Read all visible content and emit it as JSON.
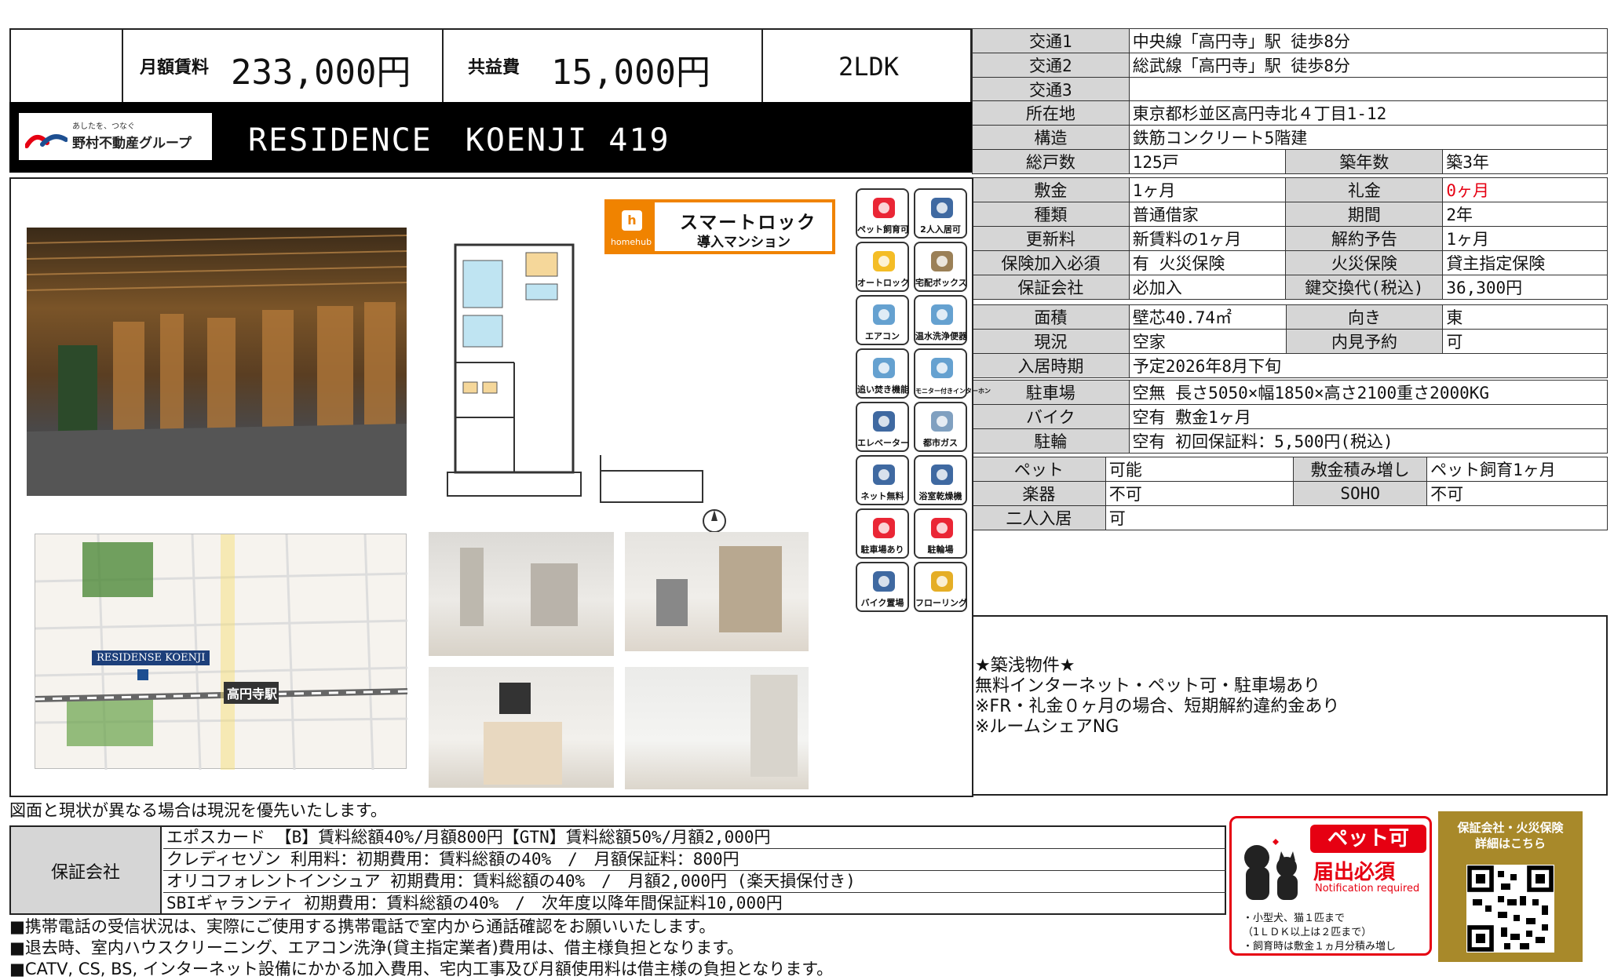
{
  "header": {
    "rent_label": "月額賃料",
    "rent_value": "233,000円",
    "fee_label": "共益費",
    "fee_value": "15,000円",
    "layout_type": "2LDK",
    "building_name": "RESIDENCE　KOENJI 419",
    "logo_tagline": "あしたを、つなぐ",
    "logo_name": "野村不動産グループ"
  },
  "transport": [
    {
      "label": "交通1",
      "value": "中央線「高円寺」駅 徒歩8分"
    },
    {
      "label": "交通2",
      "value": "総武線「高円寺」駅 徒歩8分"
    },
    {
      "label": "交通3",
      "value": ""
    }
  ],
  "building": {
    "address_label": "所在地",
    "address": "東京都杉並区高円寺北４丁目1-12",
    "structure_label": "構造",
    "structure": "鉄筋コンクリート5階建",
    "units_label": "総戸数",
    "units": "125戸",
    "age_label": "築年数",
    "age": "築3年"
  },
  "contract": {
    "deposit_label": "敷金",
    "deposit": "1ヶ月",
    "key_money_label": "礼金",
    "key_money": "0ヶ月",
    "type_label": "種類",
    "type": "普通借家",
    "period_label": "期間",
    "period": "2年",
    "renewal_label": "更新料",
    "renewal": "新賃料の1ヶ月",
    "cancel_label": "解約予告",
    "cancel": "1ヶ月",
    "insurance_label": "保険加入必須",
    "insurance": "有 火災保険",
    "fire_label": "火災保険",
    "fire": "貸主指定保険",
    "guarantor_label": "保証会社",
    "guarantor": "必加入",
    "key_label": "鍵交換代(税込)",
    "key": "36,300円"
  },
  "room": {
    "area_label": "面積",
    "area": "壁芯40.74㎡",
    "direction_label": "向き",
    "direction": "東",
    "status_label": "現況",
    "status": "空家",
    "viewing_label": "内見予約",
    "viewing": "可",
    "movein_label": "入居時期",
    "movein": "予定2026年8月下旬"
  },
  "parking": {
    "car_label": "駐車場",
    "car": "空無 長さ5050×幅1850×高さ2100重さ2000KG",
    "bike_label": "バイク",
    "bike": "空有 敷金1ヶ月",
    "bicycle_label": "駐輪",
    "bicycle": "空有 初回保証料：5,500円(税込)"
  },
  "conditions": {
    "pet_label": "ペット",
    "pet": "可能",
    "pet_deposit_label": "敷金積み増し",
    "pet_deposit": "ペット飼育1ヶ月",
    "instrument_label": "楽器",
    "instrument": "不可",
    "soho_label": "SOHO",
    "soho": "不可",
    "couple_label": "二人入居",
    "couple": "可"
  },
  "remarks": [
    "★築浅物件★",
    "無料インターネット・ペット可・駐車場あり",
    "",
    "※FR・礼金０ヶ月の場合、短期解約違約金あり",
    "※ルームシェアNG"
  ],
  "smartlock": {
    "brand": "homehub",
    "title": "スマートロック",
    "subtitle": "導入マンション"
  },
  "icons": [
    {
      "name": "pet-allowed-icon",
      "label": "ペット飼育可",
      "color": "#e60012"
    },
    {
      "name": "two-persons-icon",
      "label": "2人入居可",
      "color": "#1d4f91"
    },
    {
      "name": "autolock-icon",
      "label": "オートロック",
      "color": "#f2b100"
    },
    {
      "name": "delivery-box-icon",
      "label": "宅配ボックス",
      "color": "#8a6a3a"
    },
    {
      "name": "aircon-icon",
      "label": "エアコン",
      "color": "#4a90c8"
    },
    {
      "name": "washlet-icon",
      "label": "温水洗浄便器",
      "color": "#4a90c8"
    },
    {
      "name": "reheat-bath-icon",
      "label": "追い焚き機能",
      "color": "#4a90c8"
    },
    {
      "name": "monitor-intercom-icon",
      "label": "モニター付きインターホン",
      "color": "#4a90c8"
    },
    {
      "name": "elevator-icon",
      "label": "エレベーター",
      "color": "#1d4f91"
    },
    {
      "name": "city-gas-icon",
      "label": "都市ガス",
      "color": "#6a8fb5"
    },
    {
      "name": "free-internet-icon",
      "label": "ネット無料",
      "color": "#1d4f91"
    },
    {
      "name": "bath-dryer-icon",
      "label": "浴室乾燥機",
      "color": "#1d4f91"
    },
    {
      "name": "parking-icon",
      "label": "駐車場あり",
      "color": "#e60012"
    },
    {
      "name": "bicycle-parking-icon",
      "label": "駐輪場",
      "color": "#e60012"
    },
    {
      "name": "bike-parking-icon",
      "label": "バイク置場",
      "color": "#1d4f91"
    },
    {
      "name": "flooring-icon",
      "label": "フローリング",
      "color": "#e0a000"
    }
  ],
  "map": {
    "building_label": "RESIDENSE KOENJI",
    "station_label": "高円寺駅"
  },
  "disclaimer": "図面と現状が異なる場合は現況を優先いたします。",
  "guarantee": {
    "label": "保証会社",
    "rows": [
      "エポスカード 【B】賃料総額40%/月額800円【GTN】賃料総額50%/月額2,000円",
      "クレディセゾン 利用料：初期費用：賃料総額の40%　/　月額保証料：800円",
      "オリコフォレントインシュア 初期費用：賃料総額の40%　/　月額2,000円 (楽天損保付き)",
      "SBIギャランティ 初期費用：賃料総額の40%　/　次年度以降年間保証料10,000円"
    ]
  },
  "notices": [
    "■携帯電話の受信状況は、実際にご使用する携帯電話で室内から通話確認をお願いいたします。",
    "■退去時、室内ハウスクリーニング、エアコン洗浄(貸主指定業者)費用は、借主様負担となります。",
    "■CATV, CS, BS, インターネット設備にかかる加入費用、宅内工事及び月額使用料は借主様の負担となります。"
  ],
  "pet_badge": {
    "title": "ペット可",
    "subtitle": "届出必須",
    "english": "Notification required",
    "line1": "・小型犬、猫１匹まで",
    "line2": "（1ＬＤＫ以上は２匹まで）",
    "line3": "・飼育時は敷金１ヵ月分積み増し"
  },
  "qr_box": {
    "line1": "保証会社・火災保険",
    "line2": "詳細はこちら"
  }
}
